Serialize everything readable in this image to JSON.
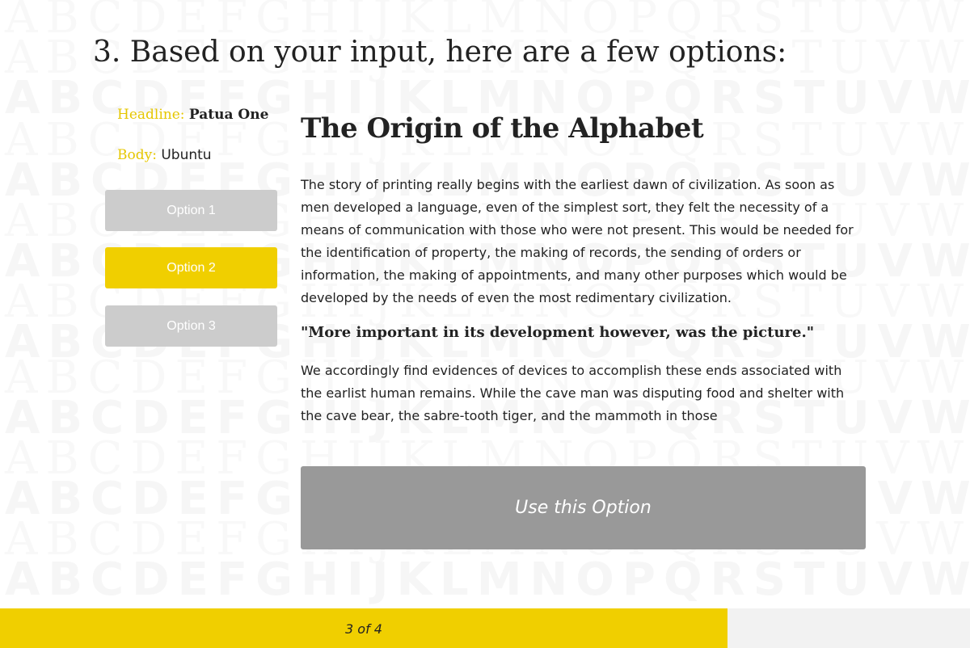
{
  "background": {
    "pattern_rows": [
      "ABCDEFGHIJKLMNOPQRSTUVWXYZAB",
      "ABCDEFGHIJKLMNOPQRSTUVWXYZAB",
      "ABCDEFGHIJKLMNOPQRSTUVWXYZAB",
      "ABCDEFGHIJKLMNOPQRSTUVWXYZAB",
      "ABCDEFGHIJKLMNOPQRSTUVWXYZAB",
      "ABCDEFGHIJKLMNOPQRSTUVWXYZAB",
      "ABCDEFGHIJKLMNOPQRSTUVWXYZAB",
      "ABCDEFGHIJKLMNOPQRSTUVWXYZAB",
      "ABCDEFGHIJKLMNOPQRSTUVWXYZAB",
      "ABCDEFGHIJKLMNOPQRSTUVWXYZAB",
      "ABCDEFGHIJKLMNOPQRSTUVWXYZAB",
      "ABCDEFGHIJKLMNOPQRSTUVWXYZAB",
      "ABCDEFGHIJKLMNOPQRSTUVWXYZAB",
      "ABCDEFGHIJKLMNOPQRSTUVWXYZAB",
      "ABCDEFGHIJKLMNOPQRSTUVWXYZAB"
    ]
  },
  "step": {
    "heading": "3. Based on your input, here are a few options:"
  },
  "fonts": {
    "headline_label": "Headline:",
    "headline_value": "Patua One",
    "body_label": "Body:",
    "body_value": "Ubuntu"
  },
  "options": [
    {
      "label": "Option 1",
      "selected": false
    },
    {
      "label": "Option 2",
      "selected": true
    },
    {
      "label": "Option 3",
      "selected": false
    }
  ],
  "preview": {
    "title": "The Origin of the Alphabet",
    "paragraph1": "The story of printing really begins with the earliest dawn of civilization. As soon as men developed a language, even of the simplest sort, they felt the necessity of a means of communication with those who were not present. This would be needed for the identification of property, the making of records, the sending of orders or information, the making of appointments, and many other purposes which would be developed by the needs of even the most redimentary civilization.",
    "quote": "\"More important in its development however, was the picture.\"",
    "paragraph2": "We accordingly find evidences of devices to accomplish these ends associated with the earlist human remains. While the cave man was disputing food and shelter with the cave bear, the sabre-tooth tiger, and the mammoth in those"
  },
  "actions": {
    "use_option_label": "Use this Option"
  },
  "progress": {
    "label": "3 of 4",
    "current": 3,
    "total": 4
  },
  "colors": {
    "accent": "#f0cf00",
    "inactive_button": "#cccccc",
    "primary_button": "#999999",
    "progress_track": "#f2f2f2"
  }
}
